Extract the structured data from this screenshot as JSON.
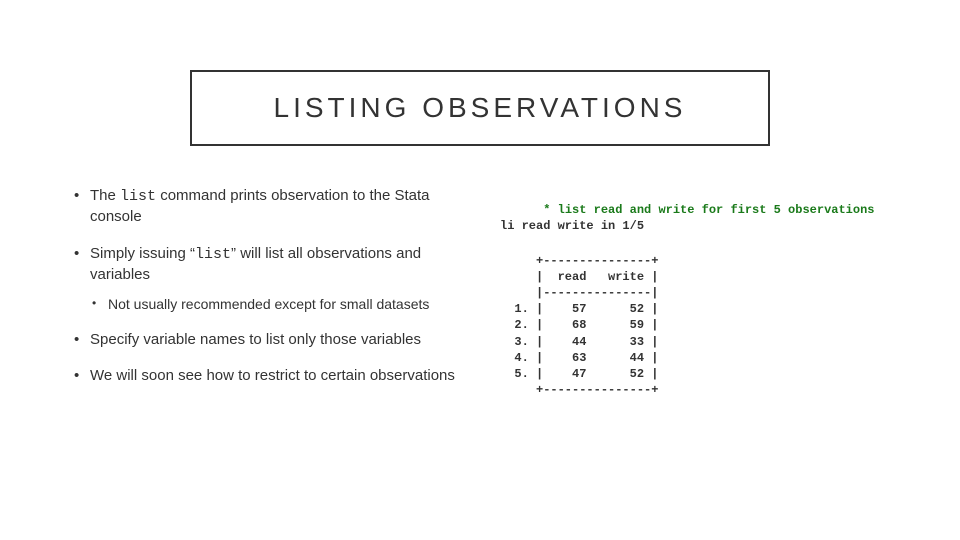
{
  "title": "LISTING OBSERVATIONS",
  "bullets": {
    "b1_pre": "The ",
    "b1_code": "list",
    "b1_post": " command prints observation to the Stata console",
    "b2_pre": "Simply issuing “",
    "b2_code": "list",
    "b2_post": "” will list all observations and variables",
    "b2a": "Not usually recommended except for small datasets",
    "b3": "Specify variable names to list only those variables",
    "b4": "We will soon see how to restrict to certain observations"
  },
  "code": {
    "comment": "* list read and write for first 5 observations",
    "cmd": "li read write in 1/5",
    "output": "     +---------------+\n     |  read   write |\n     |---------------|\n  1. |    57      52 |\n  2. |    68      59 |\n  3. |    44      33 |\n  4. |    63      44 |\n  5. |    47      52 |\n     +---------------+"
  },
  "chart_data": {
    "type": "table",
    "columns": [
      "read",
      "write"
    ],
    "rows": [
      [
        57,
        52
      ],
      [
        68,
        59
      ],
      [
        44,
        33
      ],
      [
        63,
        44
      ],
      [
        47,
        52
      ]
    ]
  }
}
